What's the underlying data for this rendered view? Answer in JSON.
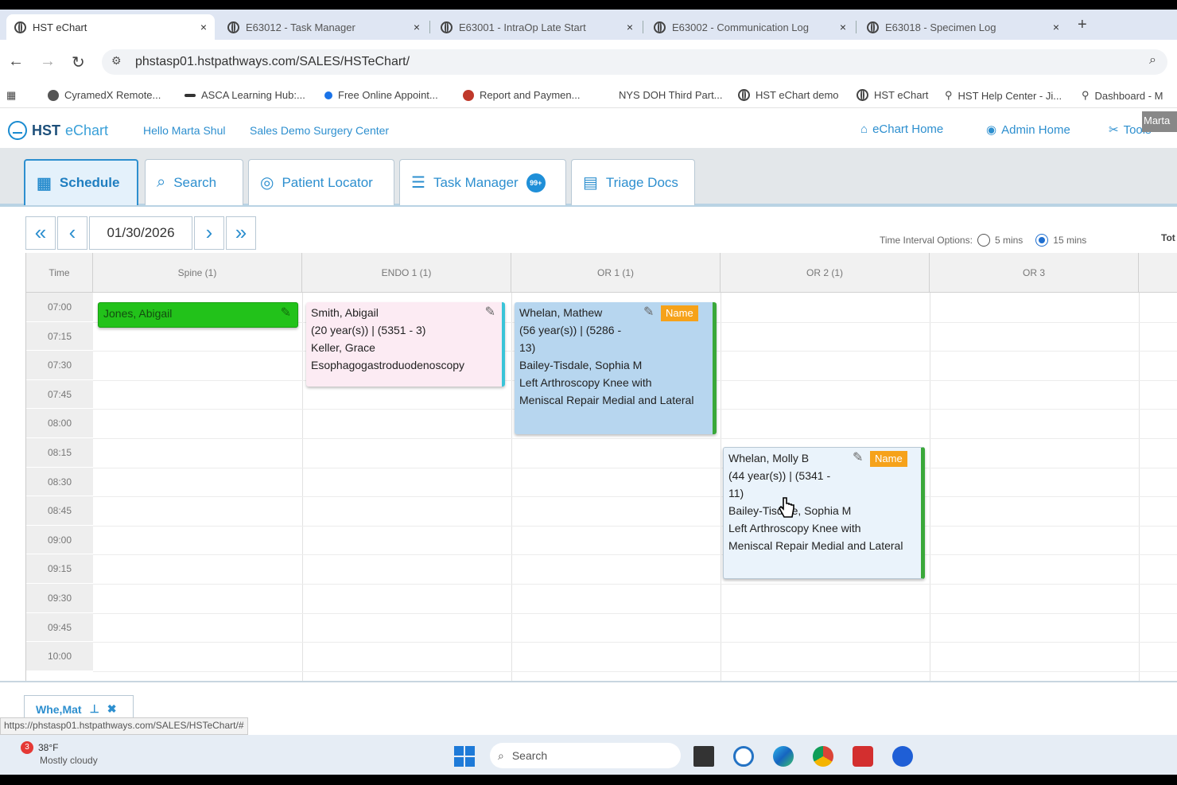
{
  "browser": {
    "tabs": [
      {
        "title": "HST eChart"
      },
      {
        "title": "E63012 - Task Manager"
      },
      {
        "title": "E63001 - IntraOp Late Start"
      },
      {
        "title": "E63002 - Communication Log"
      },
      {
        "title": "E63018 - Specimen Log"
      }
    ],
    "close_glyph": "×",
    "new_tab_glyph": "+",
    "url": "phstasp01.hstpathways.com/SALES/HSTeChart/",
    "bookmarks": [
      {
        "label": "CyramedX Remote...",
        "color": "#555555"
      },
      {
        "label": "ASCA Learning Hub:...",
        "color": "#333333"
      },
      {
        "label": "Free Online Appoint...",
        "color": "#1a73e8"
      },
      {
        "label": "Report and Paymen...",
        "color": "#c0392b"
      },
      {
        "label": "NYS DOH Third Part...",
        "color": "#ffffff"
      },
      {
        "label": "HST eChart demo",
        "color": "#444444"
      },
      {
        "label": "HST eChart",
        "color": "#444444"
      },
      {
        "label": "HST Help Center - Ji...",
        "color": "#5a5a5a"
      },
      {
        "label": "Dashboard - M",
        "color": "#5a5a5a"
      }
    ]
  },
  "app": {
    "logo_hst": "HST",
    "logo_echart": "eChart",
    "greeting": "Hello Marta Shul",
    "center": "Sales Demo Surgery Center",
    "nav": {
      "echart_home": "eChart Home",
      "admin_home": "Admin Home",
      "tools": "Tools"
    },
    "user_badge": "Marta",
    "tabs": {
      "schedule": "Schedule",
      "search": "Search",
      "patient_locator": "Patient Locator",
      "task_manager": "Task Manager",
      "task_badge": "99+",
      "triage_docs": "Triage Docs"
    }
  },
  "schedule": {
    "date": "01/30/2026",
    "interval_label": "Time Interval Options:",
    "interval_5": "5 mins",
    "interval_15": "15 mins",
    "selected_interval": "15 mins",
    "total_label": "Tot",
    "time_header": "Time",
    "rooms": [
      "Spine   (1)",
      "ENDO 1   (1)",
      "OR 1   (1)",
      "OR 2   (1)",
      "OR 3"
    ],
    "times": [
      "07:00",
      "07:15",
      "07:30",
      "07:45",
      "08:00",
      "08:15",
      "08:30",
      "08:45",
      "09:00",
      "09:15",
      "09:30",
      "09:45",
      "10:00"
    ],
    "appointments": [
      {
        "line1": "Jones, Abigail",
        "lines": [],
        "color": "#22c21a",
        "name_tag": ""
      },
      {
        "line1": "Smith, Abigail",
        "lines": [
          "(20 year(s)) | (5351 - 3)",
          "Keller, Grace",
          "Esophagogastroduodenoscopy"
        ],
        "color": "#fcebf3",
        "name_tag": ""
      },
      {
        "line1": "Whelan, Mathew",
        "lines": [
          "(56 year(s)) | (5286 -",
          "13)",
          "Bailey-Tisdale, Sophia M",
          "Left Arthroscopy Knee with",
          "Meniscal Repair Medial and Lateral"
        ],
        "color": "#b7d6ef",
        "name_tag": "Name"
      },
      {
        "line1": "Whelan, Molly B",
        "lines": [
          "(44 year(s)) | (5341 -",
          "11)",
          "Bailey-Tisdale, Sophia M",
          "Left Arthroscopy Knee with",
          "Meniscal Repair Medial and Lateral"
        ],
        "color": "#eaf3fb",
        "name_tag": "Name"
      }
    ]
  },
  "bottom": {
    "pinned_tab": "Whe,Mat",
    "status_url": "https://phstasp01.hstpathways.com/SALES/HSTeChart/#"
  },
  "taskbar": {
    "weather_temp": "38°F",
    "weather_desc": "Mostly cloudy",
    "weather_badge": "3",
    "search": "Search"
  }
}
